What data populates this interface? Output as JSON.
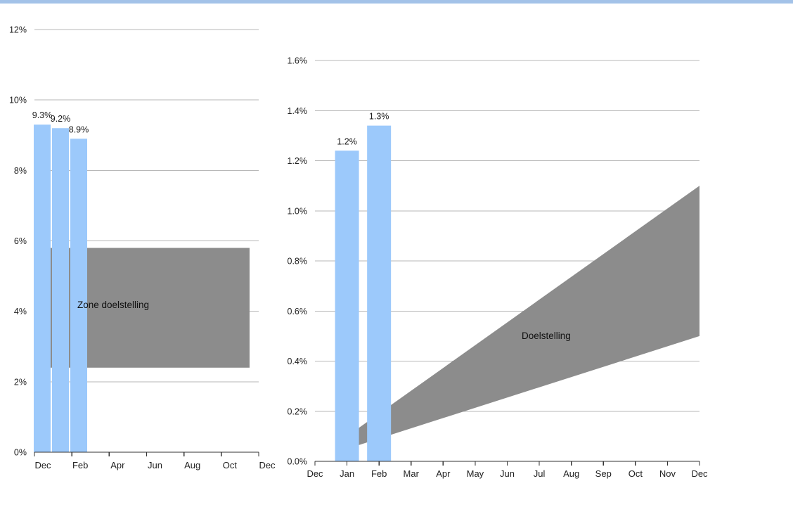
{
  "page": {
    "top_strip_color": "#a3c2e8",
    "background_color": "#ffffff"
  },
  "palette": {
    "bar": "#9cc9fb",
    "zone": "#8c8c8c",
    "gridline": "#b7b7b7",
    "axis": "#333333",
    "text": "#1a1a1a"
  },
  "chart_data": [
    {
      "id": "left",
      "type": "bar",
      "title": "",
      "xlabel": "",
      "ylabel": "",
      "ylim": [
        0,
        12
      ],
      "yticks": [
        "0%",
        "2%",
        "4%",
        "6%",
        "8%",
        "10%",
        "12%"
      ],
      "ytick_values": [
        0,
        2,
        4,
        6,
        8,
        10,
        12
      ],
      "grid": true,
      "xticks": [
        "Dec",
        "Feb",
        "Apr",
        "Jun",
        "Aug",
        "Oct",
        "Dec"
      ],
      "categories": [
        "Dec",
        "Jan",
        "Feb"
      ],
      "values": [
        9.3,
        9.2,
        8.9
      ],
      "data_labels": [
        "9.3%",
        "9.2%",
        "8.9%"
      ],
      "bands": [
        {
          "name": "Zone doelstelling",
          "label": "Zone doelstelling",
          "type": "constant_band",
          "upper": 5.8,
          "lower": 2.4,
          "x_start_month": "Dec",
          "x_end_month": "Dec",
          "color": "#8c8c8c"
        }
      ]
    },
    {
      "id": "right",
      "type": "bar",
      "title": "",
      "xlabel": "",
      "ylabel": "",
      "ylim": [
        0.0,
        1.6
      ],
      "yticks": [
        "0.0%",
        "0.2%",
        "0.4%",
        "0.6%",
        "0.8%",
        "1.0%",
        "1.2%",
        "1.4%",
        "1.6%"
      ],
      "ytick_values": [
        0.0,
        0.2,
        0.4,
        0.6,
        0.8,
        1.0,
        1.2,
        1.4,
        1.6
      ],
      "grid": true,
      "xticks": [
        "Dec",
        "Jan",
        "Feb",
        "Mar",
        "Apr",
        "May",
        "Jun",
        "Jul",
        "Aug",
        "Sep",
        "Oct",
        "Nov",
        "Dec"
      ],
      "categories": [
        "Jan",
        "Feb"
      ],
      "values": [
        1.24,
        1.34
      ],
      "data_labels": [
        "1.2%",
        "1.3%"
      ],
      "bands": [
        {
          "name": "Doelstelling",
          "label": "Doelstelling",
          "type": "widening_cone",
          "start_month": "Jan",
          "end_month": "Dec",
          "start_upper": 0.1,
          "start_lower": 0.05,
          "end_upper": 1.1,
          "end_lower": 0.5,
          "color": "#8c8c8c"
        }
      ]
    }
  ]
}
